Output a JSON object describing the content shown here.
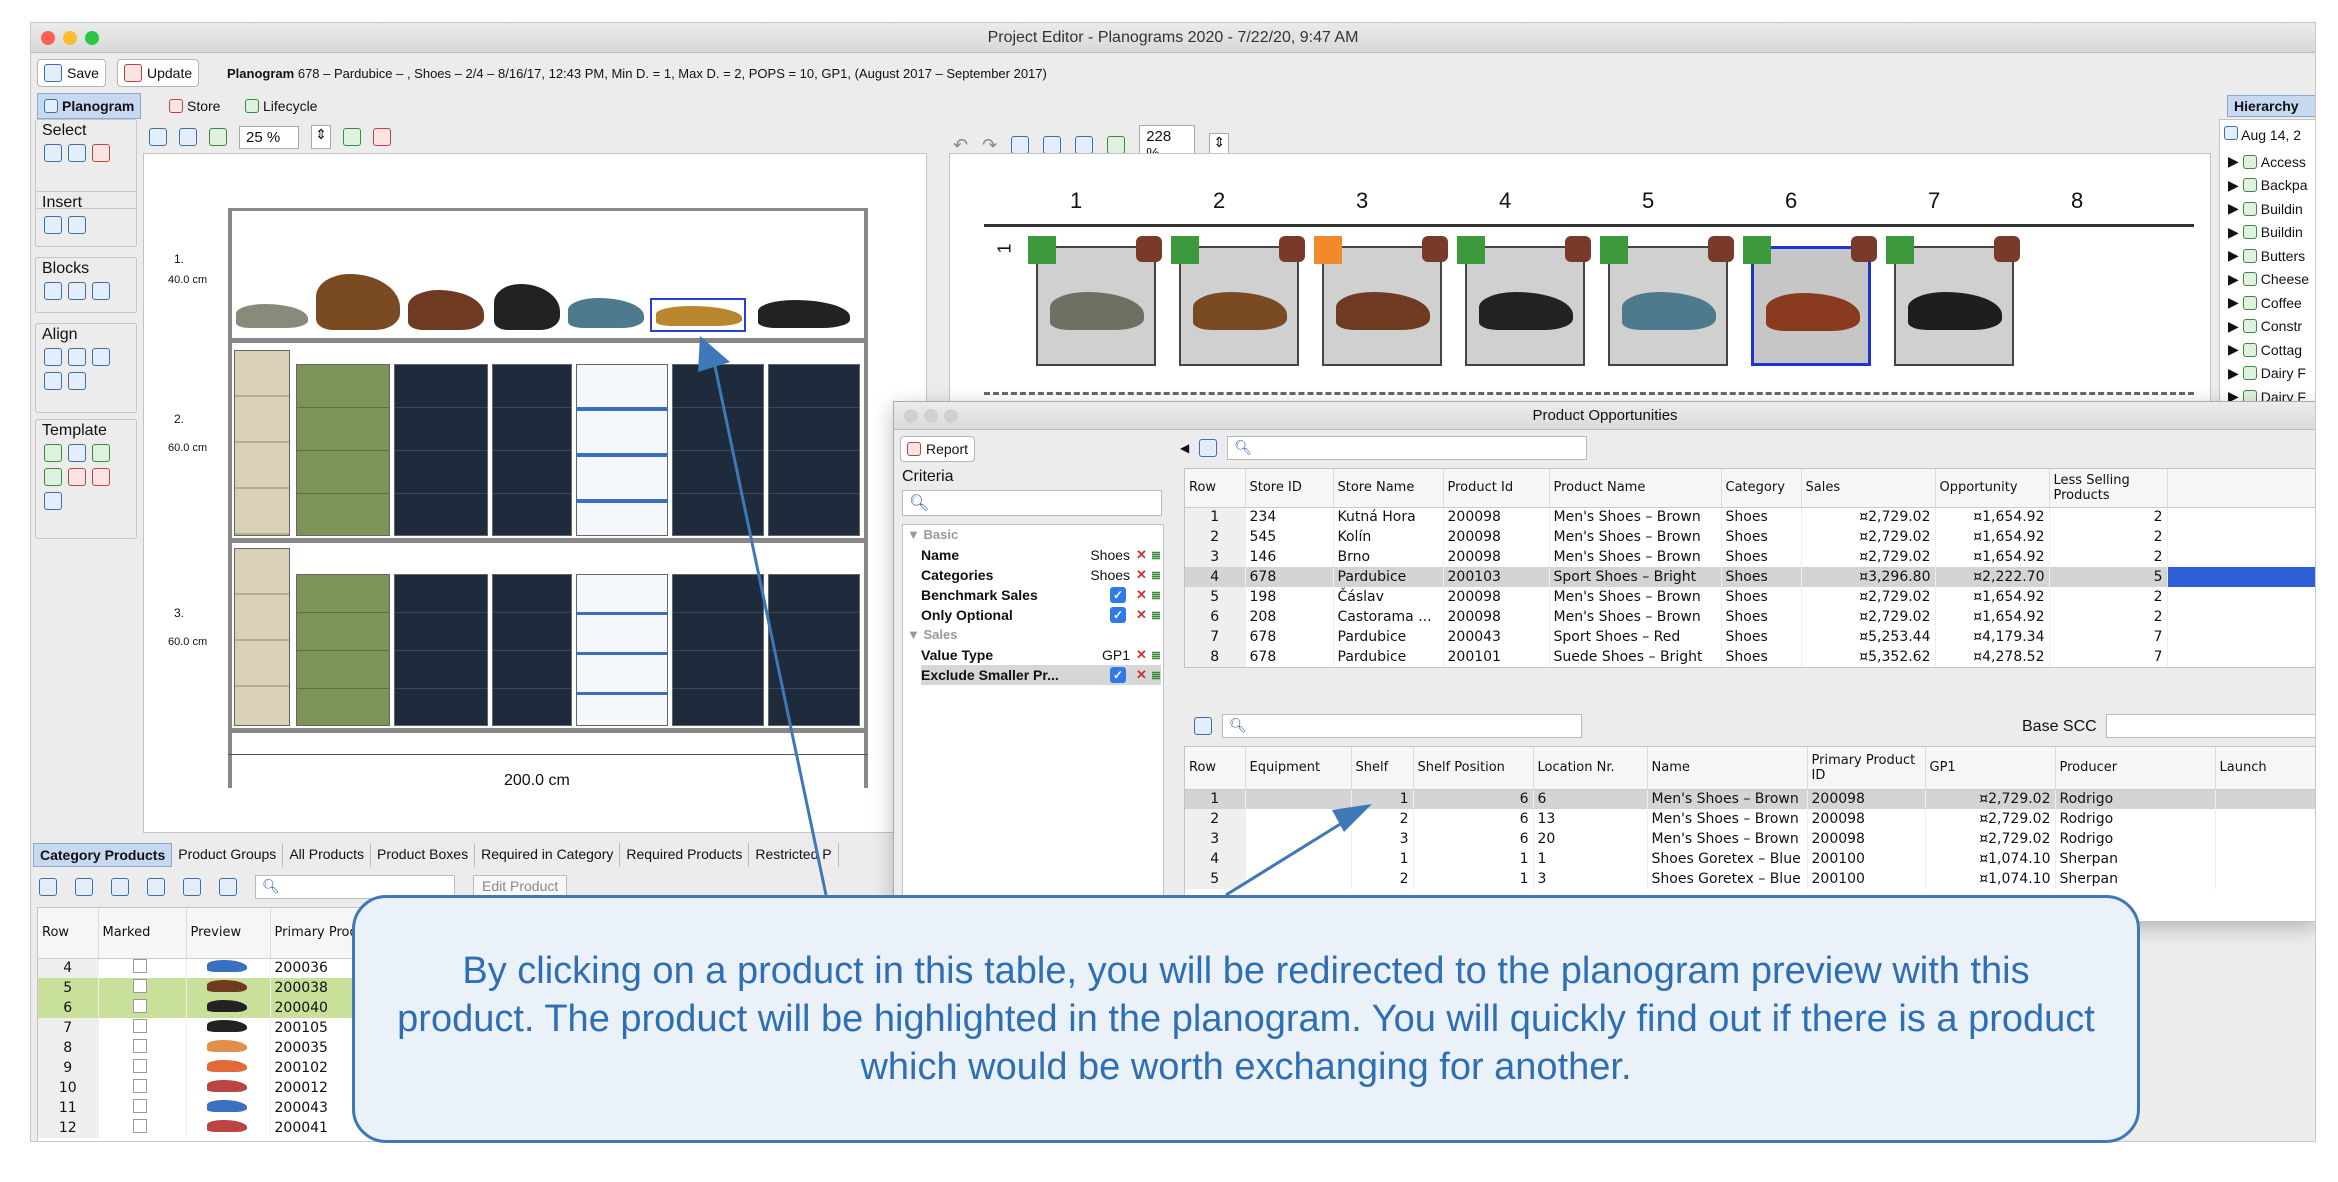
{
  "window": {
    "title": "Project Editor - Planograms 2020 - 7/22/20, 9:47 AM"
  },
  "toolbar": {
    "save_label": "Save",
    "update_label": "Update",
    "planogram_bold": "Planogram",
    "planogram_info": "678 – Pardubice – , Shoes – 2/4 – 8/16/17, 12:43 PM, Min D. = 1, Max D. = 2, POPS = 10, GP1, (August 2017 – September 2017)"
  },
  "view_tabs": [
    {
      "label": "Planogram"
    },
    {
      "label": "Store"
    },
    {
      "label": "Lifecycle"
    }
  ],
  "tool_groups": {
    "select": "Select",
    "insert": "Insert",
    "blocks": "Blocks",
    "align": "Align",
    "template": "Template"
  },
  "left_zoom": "25 %",
  "right_zoom": "228 %",
  "planogram": {
    "shelf_labels": [
      "1.",
      "2.",
      "3."
    ],
    "shelf_heights": [
      "40.0 cm",
      "60.0 cm",
      "60.0 cm"
    ],
    "width_label": "200.0 cm"
  },
  "bay_numbers": [
    "1",
    "2",
    "3",
    "4",
    "5",
    "6",
    "7",
    "8"
  ],
  "row_marker": "1",
  "hierarchy": {
    "tab": "Hierarchy",
    "root": "Aug 14, 2",
    "items": [
      "Access",
      "Backpa",
      "Buildin",
      "Buildin",
      "Butters",
      "Cheese",
      "Coffee",
      "Constr",
      "Cottag",
      "Dairy F",
      "Dairy F"
    ]
  },
  "bottom_tabs": [
    "Category Products",
    "Product Groups",
    "All Products",
    "Product Boxes",
    "Required in Category",
    "Required Products",
    "Restricted P"
  ],
  "edit_product_label": "Edit Product",
  "category_products": {
    "headers": [
      "Row",
      "Marked",
      "Preview",
      "Primary Product ID"
    ],
    "rows": [
      {
        "row": "4",
        "id": "200036"
      },
      {
        "row": "5",
        "id": "200038"
      },
      {
        "row": "6",
        "id": "200040"
      },
      {
        "row": "7",
        "id": "200105"
      },
      {
        "row": "8",
        "id": "200035"
      },
      {
        "row": "9",
        "id": "200102"
      },
      {
        "row": "10",
        "id": "200012"
      },
      {
        "row": "11",
        "id": "200043"
      },
      {
        "row": "12",
        "id": "200041"
      }
    ]
  },
  "opportunities": {
    "title": "Product Opportunities",
    "report_label": "Report",
    "criteria_label": "Criteria",
    "basic_label": "Basic",
    "sales_label": "Sales",
    "criteria": [
      {
        "name": "Name",
        "value": "Shoes",
        "checkbox": false
      },
      {
        "name": "Categories",
        "value": "Shoes",
        "checkbox": false
      },
      {
        "name": "Benchmark Sales",
        "value": "",
        "checkbox": true
      },
      {
        "name": "Only Optional",
        "value": "",
        "checkbox": true
      }
    ],
    "sales_criteria": [
      {
        "name": "Value Type",
        "value": "GP1",
        "checkbox": false
      },
      {
        "name": "Exclude Smaller Pr...",
        "value": "",
        "checkbox": true
      }
    ],
    "top_headers": [
      "Row",
      "Store ID",
      "Store Name",
      "Product Id",
      "Product Name",
      "Category",
      "Sales",
      "Opportunity",
      "Less Selling Products"
    ],
    "top_rows": [
      [
        "1",
        "234",
        "Kutná Hora",
        "200098",
        "Men's Shoes – Brown",
        "Shoes",
        "¤2,729.02",
        "¤1,654.92",
        "2"
      ],
      [
        "2",
        "545",
        "Kolín",
        "200098",
        "Men's Shoes – Brown",
        "Shoes",
        "¤2,729.02",
        "¤1,654.92",
        "2"
      ],
      [
        "3",
        "146",
        "Brno",
        "200098",
        "Men's Shoes – Brown",
        "Shoes",
        "¤2,729.02",
        "¤1,654.92",
        "2"
      ],
      [
        "4",
        "678",
        "Pardubice",
        "200103",
        "Sport Shoes – Bright",
        "Shoes",
        "¤3,296.80",
        "¤2,222.70",
        "5"
      ],
      [
        "5",
        "198",
        "Čáslav",
        "200098",
        "Men's Shoes – Brown",
        "Shoes",
        "¤2,729.02",
        "¤1,654.92",
        "2"
      ],
      [
        "6",
        "208",
        "Castorama ...",
        "200098",
        "Men's Shoes – Brown",
        "Shoes",
        "¤2,729.02",
        "¤1,654.92",
        "2"
      ],
      [
        "7",
        "678",
        "Pardubice",
        "200043",
        "Sport Shoes – Red",
        "Shoes",
        "¤5,253.44",
        "¤4,179.34",
        "7"
      ],
      [
        "8",
        "678",
        "Pardubice",
        "200101",
        "Suede Shoes – Bright",
        "Shoes",
        "¤5,352.62",
        "¤4,278.52",
        "7"
      ]
    ],
    "base_scc_label": "Base SCC",
    "bottom_headers": [
      "Row",
      "Equipment",
      "Shelf",
      "Shelf Position",
      "Location Nr.",
      "Name",
      "Primary Product ID",
      "GP1",
      "Producer",
      "Launch"
    ],
    "bottom_rows": [
      [
        "1",
        "",
        "1",
        "6",
        "6",
        "Men's Shoes – Brown",
        "200098",
        "¤2,729.02",
        "Rodrigo"
      ],
      [
        "2",
        "",
        "2",
        "6",
        "13",
        "Men's Shoes – Brown",
        "200098",
        "¤2,729.02",
        "Rodrigo"
      ],
      [
        "3",
        "",
        "3",
        "6",
        "20",
        "Men's Shoes – Brown",
        "200098",
        "¤2,729.02",
        "Rodrigo"
      ],
      [
        "4",
        "",
        "1",
        "1",
        "1",
        "Shoes Goretex – Blue",
        "200100",
        "¤1,074.10",
        "Sherpan"
      ],
      [
        "5",
        "",
        "2",
        "1",
        "3",
        "Shoes Goretex – Blue",
        "200100",
        "¤1,074.10",
        "Sherpan"
      ]
    ]
  },
  "callout": "By clicking on a product in this table, you will be redirected to the planogram preview with this product. The product will be highlighted in the planogram. You will quickly find out if there is a product which would be worth exchanging for another.",
  "colors": {
    "accent": "#3f78b7",
    "callout_bg": "#eaf1f9",
    "highlight_row": "#c8e09a"
  }
}
